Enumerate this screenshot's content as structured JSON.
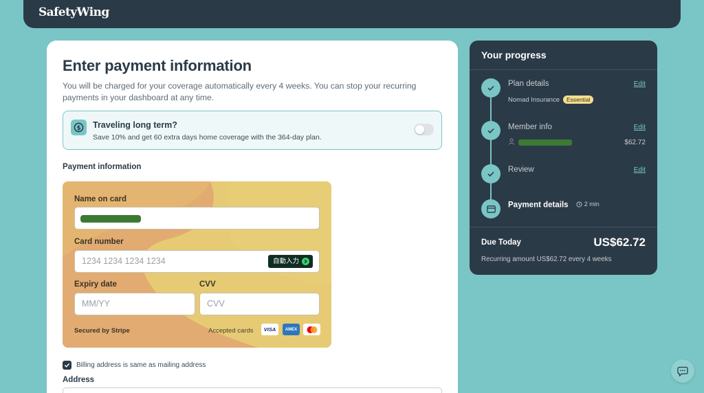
{
  "header": {
    "logo": "SafetyWing"
  },
  "payment": {
    "title": "Enter payment information",
    "description": "You will be charged for your coverage automatically every 4 weeks. You can stop your recurring payments in your dashboard at any time.",
    "promo": {
      "title": "Traveling long term?",
      "subtitle": "Save 10% and get 60 extra days home coverage with the 364-day plan.",
      "icon": "dollar-circle-icon",
      "toggle_on": false
    },
    "section_label": "Payment information",
    "card": {
      "name_label": "Name on card",
      "number_label": "Card number",
      "number_placeholder": "1234 1234 1234 1234",
      "autofill_label": "自動入力",
      "expiry_label": "Expiry date",
      "expiry_placeholder": "MM/YY",
      "cvv_label": "CVV",
      "cvv_placeholder": "CVV",
      "secured": "Secured by Stripe",
      "accepted": "Accepted cards",
      "brands": [
        "VISA",
        "AMEX",
        "mastercard"
      ]
    },
    "billing_same": "Billing address is same as mailing address",
    "billing_checked": true,
    "address_label": "Address"
  },
  "progress": {
    "title": "Your progress",
    "steps": [
      {
        "label": "Plan details",
        "edit": "Edit",
        "sub": "Nomad Insurance",
        "badge": "Essential"
      },
      {
        "label": "Member info",
        "edit": "Edit",
        "price": "$62.72"
      },
      {
        "label": "Review",
        "edit": "Edit"
      },
      {
        "label": "Payment details",
        "time": "2 min"
      }
    ],
    "due_label": "Due Today",
    "due_amount": "US$62.72",
    "recurring": "Recurring amount US$62.72 every 4 weeks"
  },
  "colors": {
    "navy": "#2b3a47",
    "teal": "#7ac5c6",
    "card_yellow": "#e6cb74",
    "card_orange": "#e2ab72"
  }
}
